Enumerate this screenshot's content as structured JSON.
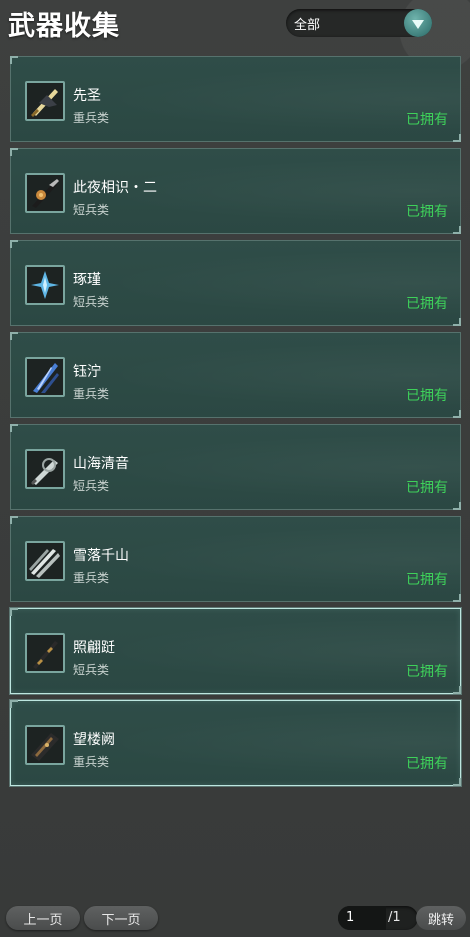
{
  "header": {
    "title": "武器收集",
    "filter_value": "全部"
  },
  "weapons": [
    {
      "name": "先圣",
      "type": "重兵类",
      "status": "已拥有",
      "icon": "great-sword-icon",
      "accent": "#d9c27a"
    },
    {
      "name": "此夜相识・二",
      "type": "短兵类",
      "status": "已拥有",
      "icon": "blade-icon",
      "accent": "#c9883c"
    },
    {
      "name": "琢瑾",
      "type": "短兵类",
      "status": "已拥有",
      "icon": "crystal-blade-icon",
      "accent": "#5fb6e6"
    },
    {
      "name": "钰泞",
      "type": "重兵类",
      "status": "已拥有",
      "icon": "blue-sword-icon",
      "accent": "#4a7fd4"
    },
    {
      "name": "山海清音",
      "type": "短兵类",
      "status": "已拥有",
      "icon": "ornate-blade-icon",
      "accent": "#cfd8d6"
    },
    {
      "name": "雪落千山",
      "type": "重兵类",
      "status": "已拥有",
      "icon": "twin-blade-icon",
      "accent": "#e0e6e4"
    },
    {
      "name": "照翩跹",
      "type": "短兵类",
      "status": "已拥有",
      "icon": "gold-dagger-icon",
      "accent": "#b89045"
    },
    {
      "name": "望楼阙",
      "type": "重兵类",
      "status": "已拥有",
      "icon": "dark-broadsword-icon",
      "accent": "#8d6a3e"
    }
  ],
  "pagination": {
    "prev_label": "上一页",
    "next_label": "下一页",
    "current_page": "1",
    "total_pages": "/1",
    "jump_label": "跳转"
  }
}
